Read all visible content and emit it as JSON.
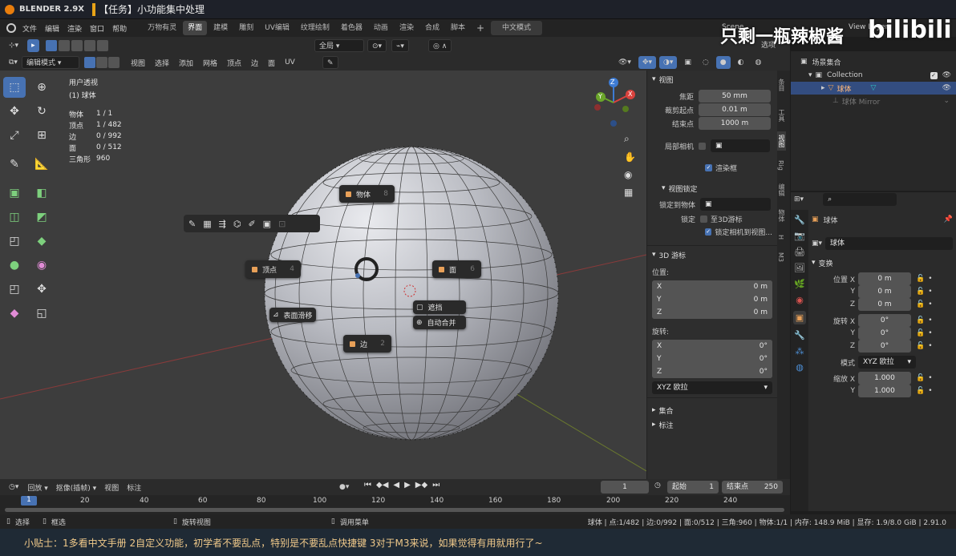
{
  "titlebar": {
    "app": "BLENDER 2.9X",
    "task": "【任务】小功能集中处理",
    "watermark": "只剩一瓶辣椒酱",
    "brand": "bilibili"
  },
  "menu": {
    "items": [
      "文件",
      "编辑",
      "渲染",
      "窗口",
      "帮助"
    ]
  },
  "workspace_tabs": [
    "万物有灵",
    "界面",
    "建模",
    "雕刻",
    "UV编辑",
    "纹理绘制",
    "着色器",
    "动画",
    "渲染",
    "合成",
    "脚本"
  ],
  "active_tab": "界面",
  "lang_mode": "中文模式",
  "scene": {
    "name": "Scene",
    "view_layer": "View Layer"
  },
  "tool_header": {
    "orientation": "全局",
    "options": "选项"
  },
  "viewport_header": {
    "mode": "编辑模式",
    "menus": [
      "视图",
      "选择",
      "添加",
      "网格",
      "顶点",
      "边",
      "面",
      "UV"
    ]
  },
  "viewport": {
    "view_name": "用户透视",
    "object_name": "(1) 球体",
    "stats": [
      {
        "label": "物体",
        "value": "1 / 1"
      },
      {
        "label": "顶点",
        "value": "1 / 482"
      },
      {
        "label": "边",
        "value": "0 / 992"
      },
      {
        "label": "面",
        "value": "0 / 512"
      },
      {
        "label": "三角形",
        "value": "960"
      }
    ],
    "pie": {
      "object": {
        "label": "物体",
        "key": "8"
      },
      "vertex": {
        "label": "顶点",
        "key": "4"
      },
      "face": {
        "label": "面",
        "key": "6"
      },
      "edge": {
        "label": "边",
        "key": "2"
      },
      "surface_slide": "表面滑移",
      "occlude": "遮挡",
      "auto_merge": "自动合并"
    },
    "gizmo": {
      "x": "X",
      "y": "Y",
      "z": "Z"
    }
  },
  "npanel": {
    "tabs": [
      "条目",
      "工具",
      "视图",
      "Rig",
      "编辑",
      "物体",
      "H",
      "M3"
    ],
    "view_section": "视图",
    "focal_label": "焦距",
    "focal_value": "50 mm",
    "clip_start_label": "裁剪起点",
    "clip_start_value": "0.01 m",
    "clip_end_label": "结束点",
    "clip_end_value": "1000 m",
    "local_camera_label": "局部相机",
    "render_region_label": "渲染框",
    "view_lock_section": "视图锁定",
    "lock_to_object_label": "锁定到物体",
    "lock_label": "锁定",
    "to_3d_cursor_label": "至3D游标",
    "lock_camera_label": "锁定相机到视图...",
    "cursor_section": "3D 游标",
    "location_label": "位置:",
    "loc": [
      {
        "axis": "X",
        "value": "0 m"
      },
      {
        "axis": "Y",
        "value": "0 m"
      },
      {
        "axis": "Z",
        "value": "0 m"
      }
    ],
    "rotation_label": "旋转:",
    "rot": [
      {
        "axis": "X",
        "value": "0°"
      },
      {
        "axis": "Y",
        "value": "0°"
      },
      {
        "axis": "Z",
        "value": "0°"
      }
    ],
    "euler": "XYZ 欧拉",
    "collections_section": "集合",
    "annotations_section": "标注"
  },
  "outliner": {
    "scene_collection": "场景集合",
    "collection": "Collection",
    "object": "球体",
    "modifier": "球体 Mirror"
  },
  "properties": {
    "object_name": "球体",
    "data_name": "球体",
    "transform_section": "变换",
    "location_label": "位置",
    "loc": [
      {
        "axis": "X",
        "value": "0 m"
      },
      {
        "axis": "Y",
        "value": "0 m"
      },
      {
        "axis": "Z",
        "value": "0 m"
      }
    ],
    "rotation_label": "旋转",
    "rot": [
      {
        "axis": "X",
        "value": "0°"
      },
      {
        "axis": "Y",
        "value": "0°"
      },
      {
        "axis": "Z",
        "value": "0°"
      }
    ],
    "mode_label": "模式",
    "mode_value": "XYZ 欧拉",
    "scale_label": "缩放",
    "scale": [
      {
        "axis": "X",
        "value": "1.000"
      },
      {
        "axis": "Y",
        "value": "1.000"
      }
    ]
  },
  "timeline": {
    "menus": [
      "回放",
      "抠像(插帧)",
      "视图",
      "标注"
    ],
    "current_frame": "1",
    "start_label": "起始",
    "start_value": "1",
    "end_label": "结束点",
    "end_value": "250",
    "ticks": [
      "1",
      "20",
      "40",
      "60",
      "80",
      "100",
      "120",
      "140",
      "160",
      "180",
      "200",
      "220",
      "240"
    ]
  },
  "statusbar": {
    "select": "选择",
    "box_select": "框选",
    "rotate_view": "旋转视图",
    "call_menu": "调用菜单",
    "info": "球体 | 点:1/482 | 边:0/992 | 面:0/512 | 三角:960 | 物体:1/1 | 内存: 148.9 MiB | 显存: 1.9/8.0 GiB | 2.91.0"
  },
  "subtitle": "小贴士：1多看中文手册 2自定义功能，初学者不要乱点，特别是不要乱点快捷键 3对于M3来说，如果觉得有用就用行了~",
  "colors": {
    "accent": "#4772b3",
    "selected_vertex": "#ff8c1a",
    "viewport_bg": "#3d3d3d"
  }
}
